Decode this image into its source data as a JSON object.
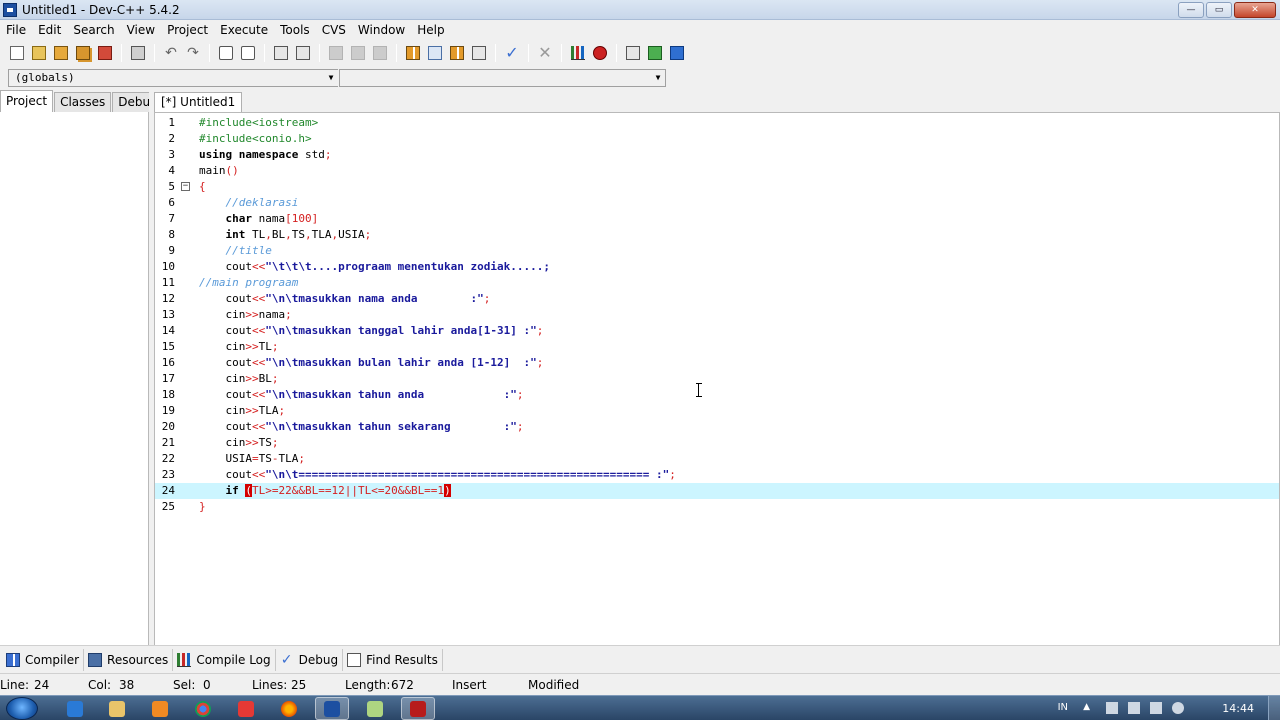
{
  "window": {
    "title": "Untitled1 - Dev-C++ 5.4.2",
    "buttons": {
      "minimize": "—",
      "maximize": "▭",
      "close": "✕"
    }
  },
  "menu": [
    "File",
    "Edit",
    "Search",
    "View",
    "Project",
    "Execute",
    "Tools",
    "CVS",
    "Window",
    "Help"
  ],
  "toolbar_icons": [
    "new-file-icon",
    "open-file-icon",
    "save-icon",
    "save-all-icon",
    "close-file-icon",
    "print-icon",
    "undo-icon",
    "redo-icon",
    "find-icon",
    "replace-icon",
    "indent-icon",
    "unindent-icon",
    "toggle-bookmark-icon",
    "goto-bookmark-icon",
    "goto-line-icon",
    "new-project-icon",
    "open-project-icon",
    "project-options-icon",
    "class-browser-icon",
    "compile-icon",
    "stop-icon",
    "profile-icon",
    "debug-icon",
    "add-file-icon",
    "remove-file-icon",
    "help-icon"
  ],
  "combos": {
    "scope": "(globals)",
    "member": ""
  },
  "left_panel": {
    "tabs": [
      "Project",
      "Classes",
      "Debug"
    ],
    "active": "Project"
  },
  "editor": {
    "tab_label": "[*] Untitled1",
    "active_line": 24,
    "lines": [
      {
        "n": "1",
        "fold": "",
        "html": "<span class=\"c-pp\">#include&lt;iostream&gt;</span>"
      },
      {
        "n": "2",
        "fold": "",
        "html": "<span class=\"c-pp\">#include&lt;conio.h&gt;</span>"
      },
      {
        "n": "3",
        "fold": "",
        "html": "<span class=\"c-kw\">using namespace</span> std<span class=\"c-op\">;</span>"
      },
      {
        "n": "4",
        "fold": "",
        "html": "main<span class=\"c-op\">()</span>"
      },
      {
        "n": "5",
        "fold": "−",
        "html": "<span class=\"c-op\">{</span>"
      },
      {
        "n": "6",
        "fold": "",
        "html": "    <span class=\"c-cm\">//deklarasi</span>"
      },
      {
        "n": "7",
        "fold": "",
        "html": "    <span class=\"c-kw\">char</span> nama<span class=\"c-op\">[</span><span class=\"c-hl\">100</span><span class=\"c-op\">]</span>"
      },
      {
        "n": "8",
        "fold": "",
        "html": "    <span class=\"c-kw\">int</span> TL<span class=\"c-op\">,</span>BL<span class=\"c-op\">,</span>TS<span class=\"c-op\">,</span>TLA<span class=\"c-op\">,</span>USIA<span class=\"c-op\">;</span>"
      },
      {
        "n": "9",
        "fold": "",
        "html": "    <span class=\"c-cm\">//title</span>"
      },
      {
        "n": "10",
        "fold": "",
        "html": "    cout<span class=\"c-op\">&lt;&lt;</span><span class=\"c-str\">\"\\t\\t\\t....prograam menentukan zodiak.....;</span>"
      },
      {
        "n": "11",
        "fold": "",
        "html": "<span class=\"c-cm\">//main prograam</span>"
      },
      {
        "n": "12",
        "fold": "",
        "html": "    cout<span class=\"c-op\">&lt;&lt;</span><span class=\"c-str\">\"\\n\\tmasukkan nama anda        :\"</span><span class=\"c-op\">;</span>"
      },
      {
        "n": "13",
        "fold": "",
        "html": "    cin<span class=\"c-op\">&gt;&gt;</span>nama<span class=\"c-op\">;</span>"
      },
      {
        "n": "14",
        "fold": "",
        "html": "    cout<span class=\"c-op\">&lt;&lt;</span><span class=\"c-str\">\"\\n\\tmasukkan tanggal lahir anda[1-31] :\"</span><span class=\"c-op\">;</span>"
      },
      {
        "n": "15",
        "fold": "",
        "html": "    cin<span class=\"c-op\">&gt;&gt;</span>TL<span class=\"c-op\">;</span>"
      },
      {
        "n": "16",
        "fold": "",
        "html": "    cout<span class=\"c-op\">&lt;&lt;</span><span class=\"c-str\">\"\\n\\tmasukkan bulan lahir anda [1-12]  :\"</span><span class=\"c-op\">;</span>"
      },
      {
        "n": "17",
        "fold": "",
        "html": "    cin<span class=\"c-op\">&gt;&gt;</span>BL<span class=\"c-op\">;</span>"
      },
      {
        "n": "18",
        "fold": "",
        "html": "    cout<span class=\"c-op\">&lt;&lt;</span><span class=\"c-str\">\"\\n\\tmasukkan tahun anda            :\"</span><span class=\"c-op\">;</span>"
      },
      {
        "n": "19",
        "fold": "",
        "html": "    cin<span class=\"c-op\">&gt;&gt;</span>TLA<span class=\"c-op\">;</span>"
      },
      {
        "n": "20",
        "fold": "",
        "html": "    cout<span class=\"c-op\">&lt;&lt;</span><span class=\"c-str\">\"\\n\\tmasukkan tahun sekarang        :\"</span><span class=\"c-op\">;</span>"
      },
      {
        "n": "21",
        "fold": "",
        "html": "    cin<span class=\"c-op\">&gt;&gt;</span>TS<span class=\"c-op\">;</span>"
      },
      {
        "n": "22",
        "fold": "",
        "html": "    USIA<span class=\"c-op\">=</span>TS<span class=\"c-op\">-</span>TLA<span class=\"c-op\">;</span>"
      },
      {
        "n": "23",
        "fold": "",
        "html": "    cout<span class=\"c-op\">&lt;&lt;</span><span class=\"c-str\">\"\\n\\t===================================================== :\"</span><span class=\"c-op\">;</span>"
      },
      {
        "n": "24",
        "fold": "",
        "html": "    <span class=\"c-kw\">if</span> <span class=\"c-brk\">(</span><span class=\"c-hl\">TL&gt;=22&amp;&amp;BL==12||TL&lt;=20&amp;&amp;BL==1</span><span class=\"c-brk\">)</span>"
      },
      {
        "n": "25",
        "fold": "",
        "html": "<span class=\"c-op\">}</span>"
      }
    ]
  },
  "bottom_tabs": [
    "Compiler",
    "Resources",
    "Compile Log",
    "Debug",
    "Find Results"
  ],
  "status": {
    "line_label": "Line:",
    "line": "24",
    "col_label": "Col:",
    "col": "38",
    "sel_label": "Sel:",
    "sel": "0",
    "lines_label": "Lines:",
    "lines": "25",
    "length_label": "Length:",
    "length": "672",
    "mode": "Insert",
    "state": "Modified"
  },
  "taskbar": {
    "tray_lang": "IN",
    "clock": "14:44"
  },
  "colors": {
    "active_line": "#ccf5ff",
    "string": "#1a1a9c",
    "preprocessor": "#21882c",
    "comment": "#5a9ad8",
    "operator": "#d42020"
  }
}
